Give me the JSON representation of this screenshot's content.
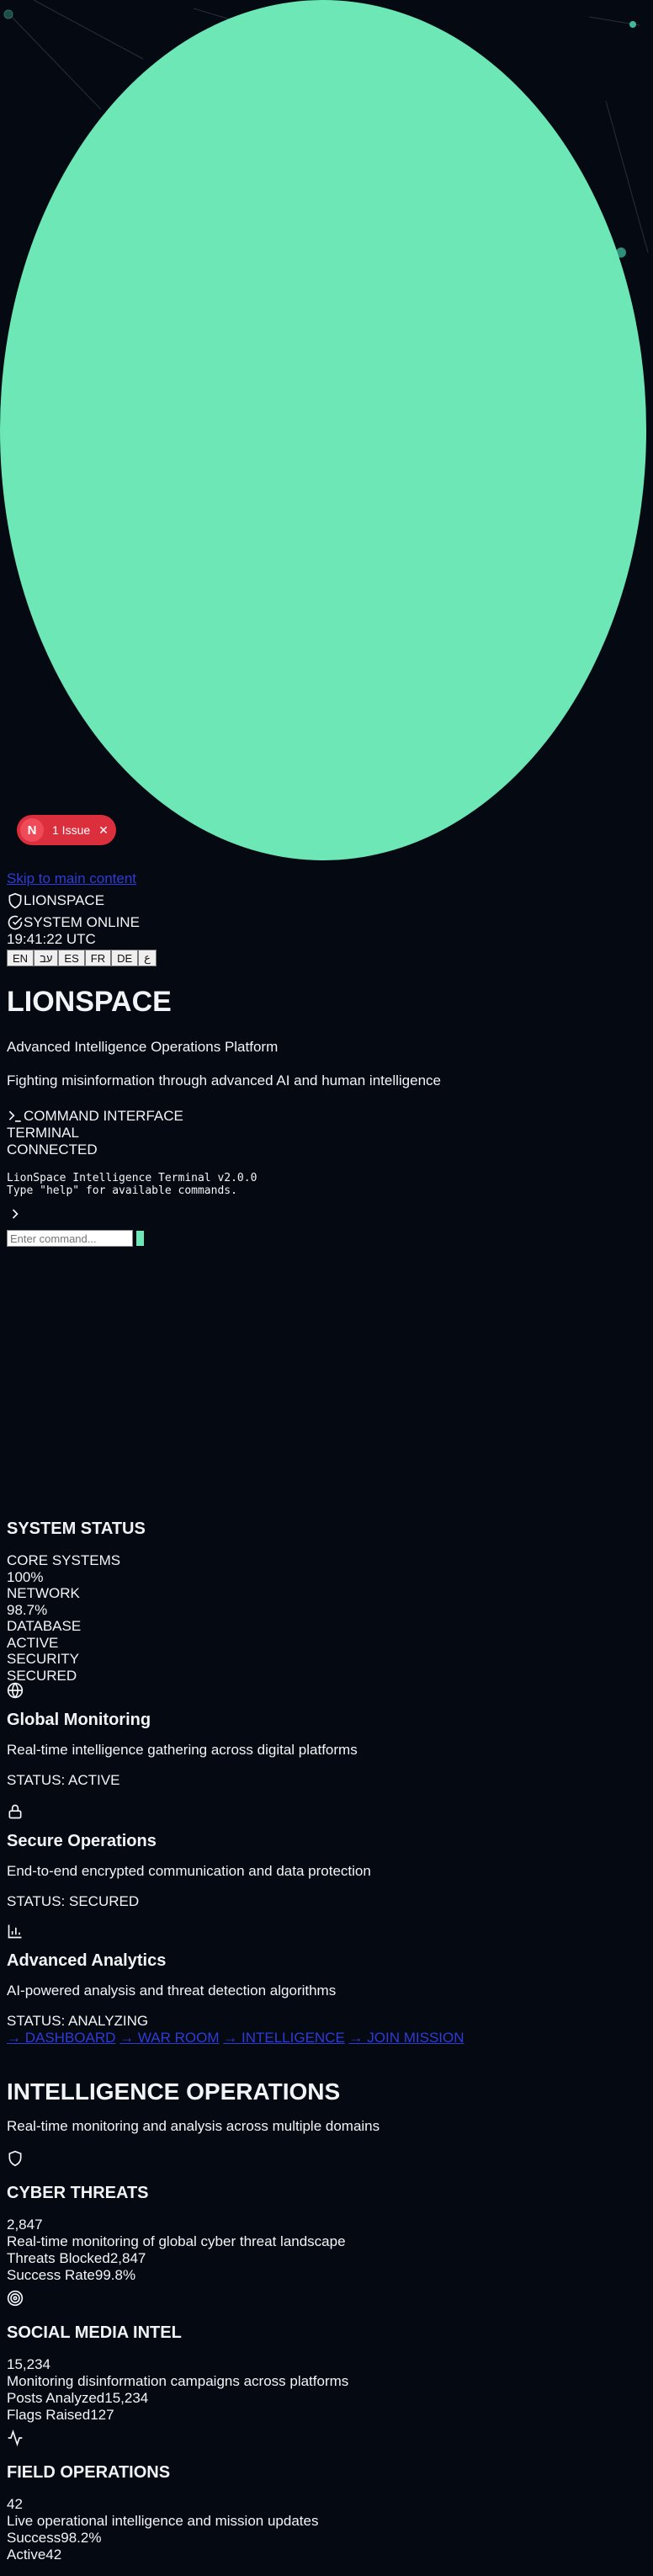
{
  "issue_badge": {
    "logo": "N",
    "label": "1 Issue",
    "close": "✕"
  },
  "skip_link": "Skip to main content",
  "brand": {
    "name": "LIONSPACE"
  },
  "system": {
    "status": "SYSTEM ONLINE",
    "time": "19:41:22 UTC"
  },
  "languages": [
    "EN",
    "עב",
    "ES",
    "FR",
    "DE",
    "ع"
  ],
  "hero": {
    "title": "LIONSPACE",
    "tagline": "Advanced Intelligence Operations Platform",
    "mission": "Fighting misinformation through advanced AI and human intelligence"
  },
  "command": {
    "title": "COMMAND INTERFACE",
    "terminal_label": "TERMINAL",
    "connection": "CONNECTED",
    "terminal_lines": [
      "LionSpace Intelligence Terminal v2.0.0",
      "Type \"help\" for available commands."
    ],
    "input_placeholder": "Enter command..."
  },
  "system_status": {
    "title": "SYSTEM STATUS",
    "items": [
      {
        "label": "CORE SYSTEMS",
        "value": "100%"
      },
      {
        "label": "NETWORK",
        "value": "98.7%"
      },
      {
        "label": "DATABASE",
        "value": "ACTIVE"
      },
      {
        "label": "SECURITY",
        "value": "SECURED"
      }
    ]
  },
  "features": [
    {
      "icon": "globe-icon",
      "title": "Global Monitoring",
      "desc": "Real-time intelligence gathering across digital platforms",
      "status": "STATUS: ACTIVE"
    },
    {
      "icon": "lock-icon",
      "title": "Secure Operations",
      "desc": "End-to-end encrypted communication and data protection",
      "status": "STATUS: SECURED"
    },
    {
      "icon": "bar-chart-icon",
      "title": "Advanced Analytics",
      "desc": "AI-powered analysis and threat detection algorithms",
      "status": "STATUS: ANALYZING"
    }
  ],
  "nav_links": [
    "→ DASHBOARD",
    "→ WAR ROOM",
    "→ INTELLIGENCE",
    "→ JOIN MISSION"
  ],
  "operations": {
    "title": "INTELLIGENCE OPERATIONS",
    "subtitle": "Real-time monitoring and analysis across multiple domains",
    "cards": [
      {
        "icon": "shield-icon",
        "title": "CYBER THREATS",
        "number": "2,847",
        "desc": "Real-time monitoring of global cyber threat landscape",
        "stats": [
          {
            "label": "Threats Blocked",
            "value": "2,847"
          },
          {
            "label": "Success Rate",
            "value": "99.8%"
          }
        ]
      },
      {
        "icon": "target-icon",
        "title": "SOCIAL MEDIA INTEL",
        "number": "15,234",
        "desc": "Monitoring disinformation campaigns across platforms",
        "stats": [
          {
            "label": "Posts Analyzed",
            "value": "15,234"
          },
          {
            "label": "Flags Raised",
            "value": "127"
          }
        ]
      },
      {
        "icon": "activity-icon",
        "title": "FIELD OPERATIONS",
        "number": "42",
        "desc": "Live operational intelligence and mission updates",
        "stats": [
          {
            "label": "Success",
            "value": "98.2%"
          },
          {
            "label": "Active",
            "value": "42"
          }
        ]
      }
    ]
  }
}
